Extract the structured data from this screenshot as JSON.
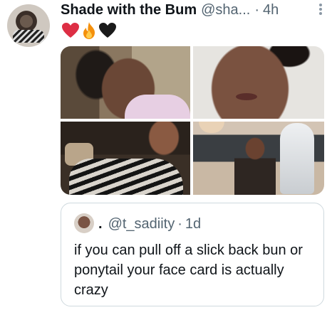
{
  "tweet": {
    "author": {
      "display_name": "Shade with the Bum",
      "handle": "@sha...",
      "separator": "·",
      "time": "4h",
      "avatar_icon": "profile-photo"
    },
    "emojis": [
      "red-heart",
      "fire",
      "black-heart"
    ],
    "media": [
      {
        "icon": "photo-woman-closeup"
      },
      {
        "icon": "photo-woman-face"
      },
      {
        "icon": "photo-woman-striped-dress"
      },
      {
        "icon": "photo-woman-restaurant-robot"
      }
    ],
    "quoted": {
      "display_name": ".",
      "handle": "@t_sadiity",
      "separator": "·",
      "time": "1d",
      "text": "if you can pull off a slick back bun or ponytail your face card is actually crazy"
    }
  },
  "colors": {
    "text_primary": "#0f1419",
    "text_secondary": "#536471",
    "border": "#cfd9de"
  }
}
